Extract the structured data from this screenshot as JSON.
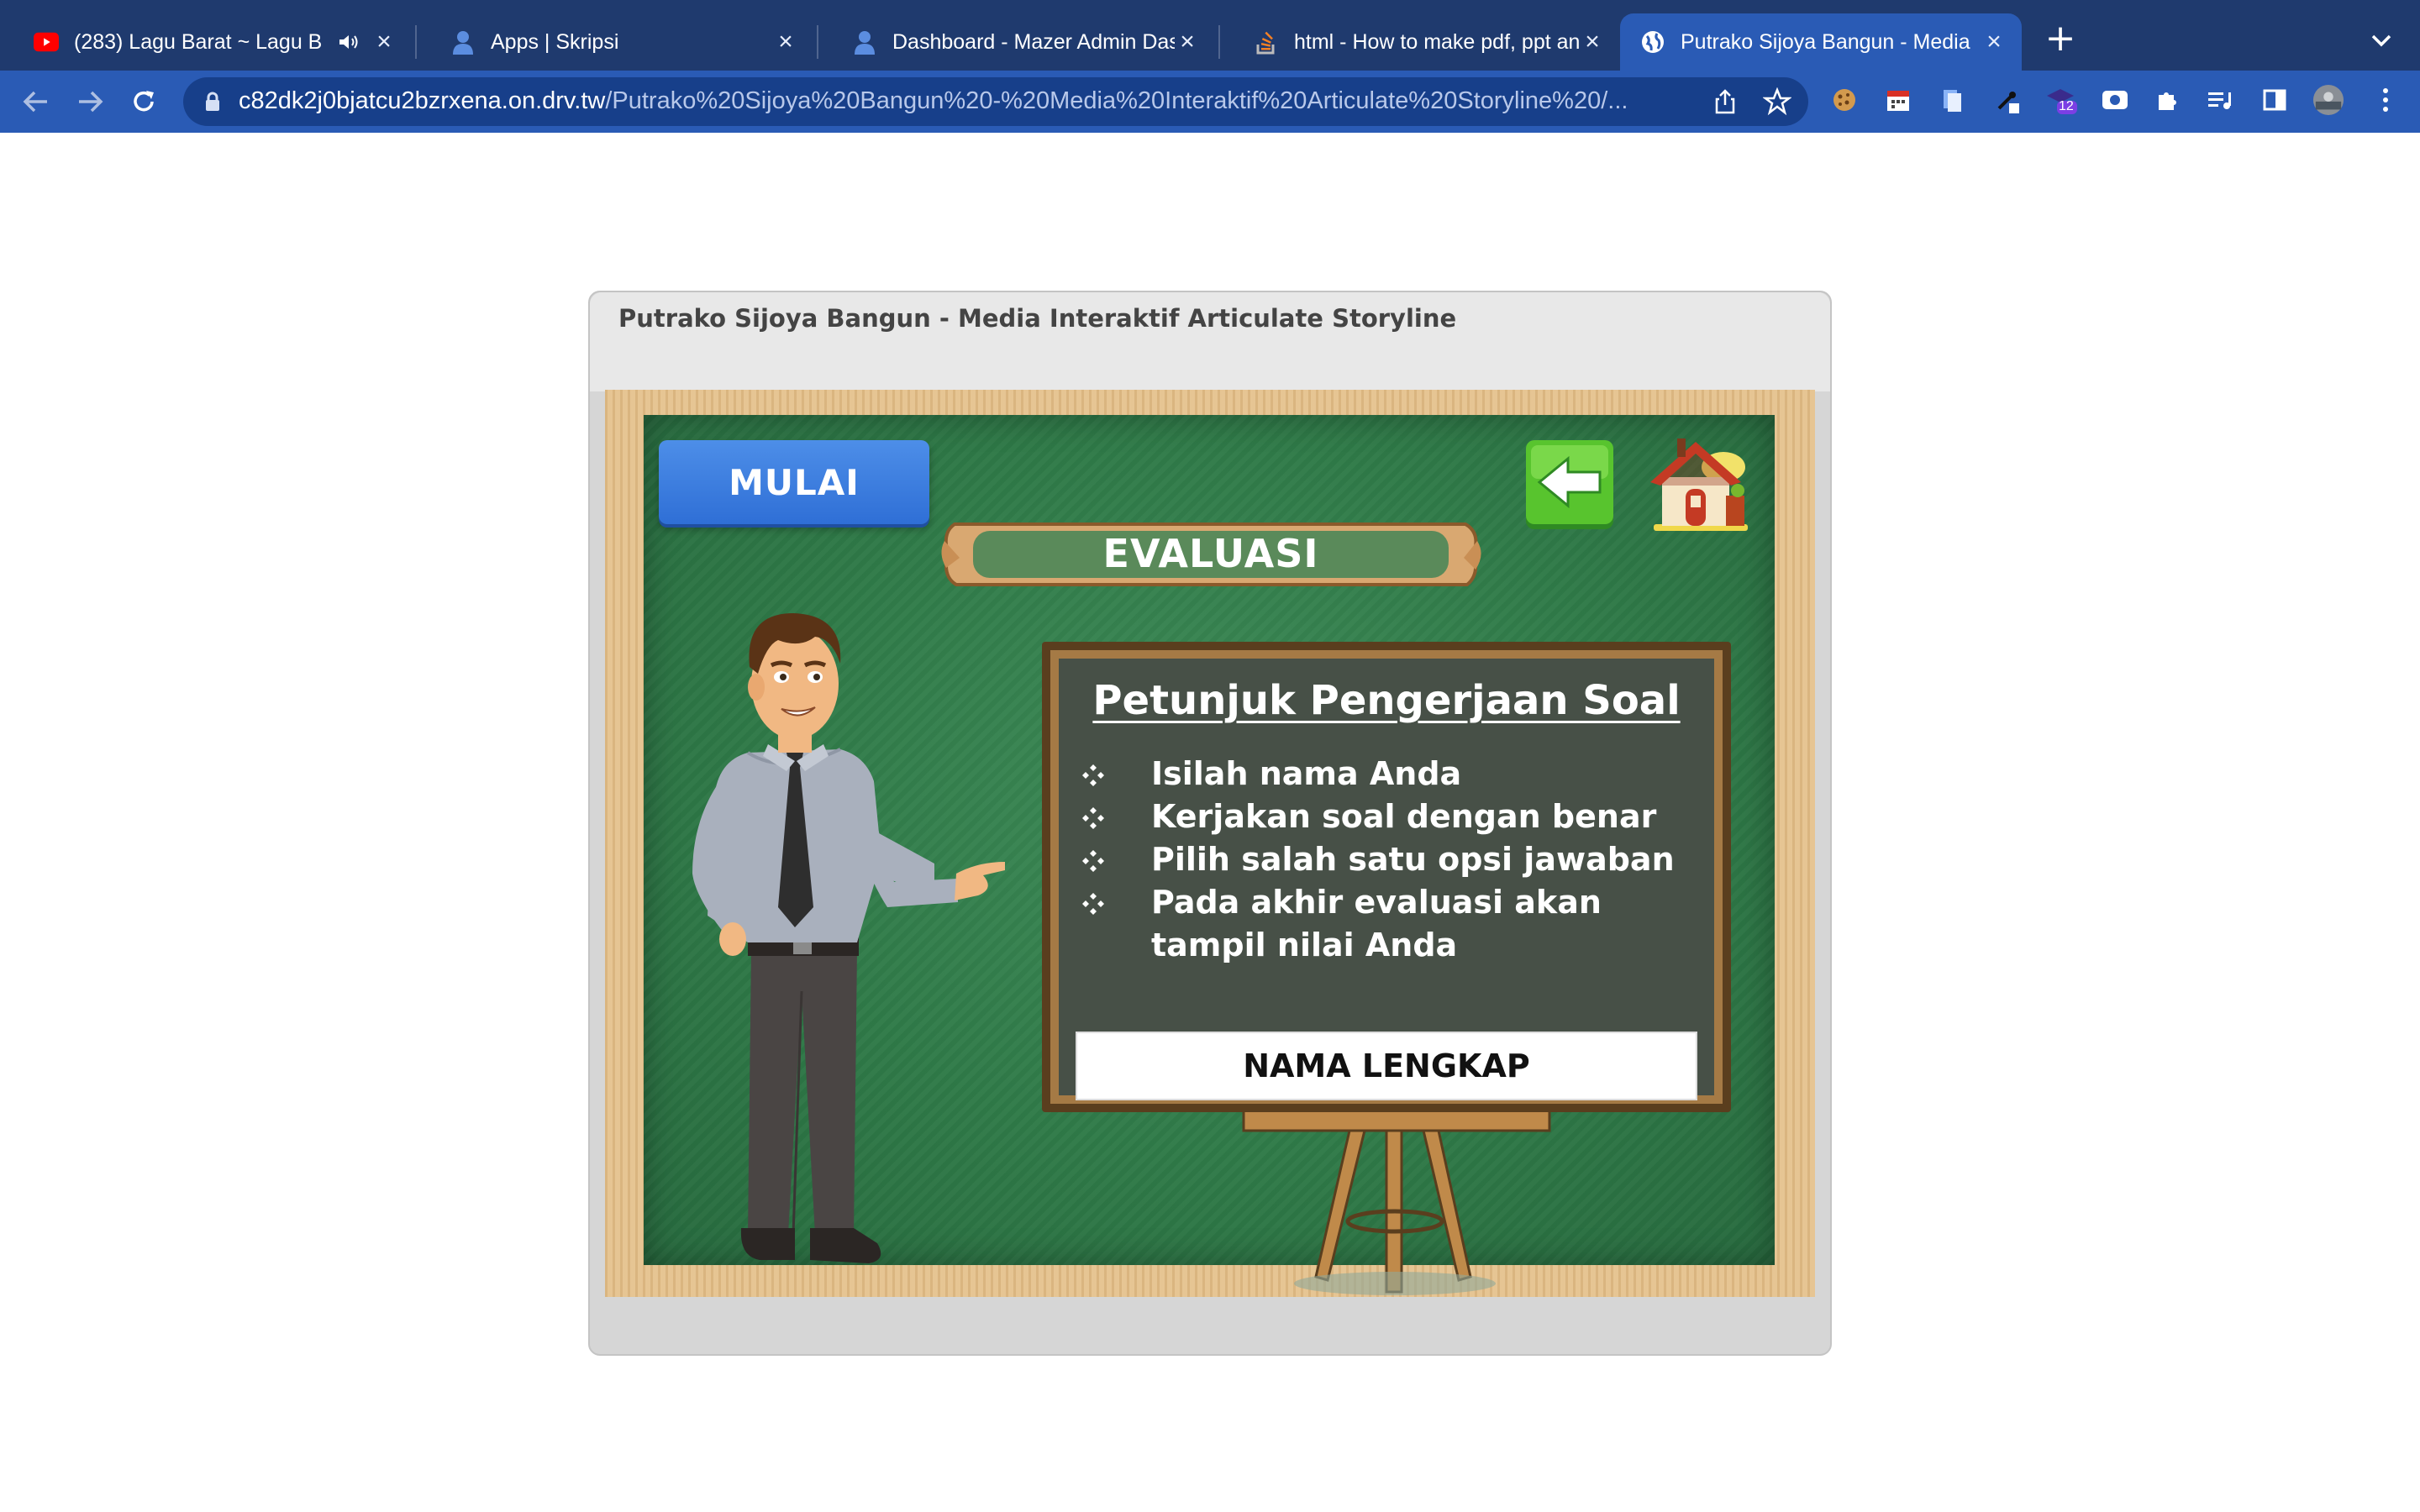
{
  "browser": {
    "tabs": [
      {
        "title": "(283) Lagu Barat ~ Lagu B",
        "icon": "youtube-icon",
        "audio": true
      },
      {
        "title": "Apps | Skripsi",
        "icon": "profile-icon"
      },
      {
        "title": "Dashboard - Mazer Admin Dash",
        "icon": "profile-icon"
      },
      {
        "title": "html - How to make pdf, ppt an",
        "icon": "stackoverflow-icon"
      },
      {
        "title": "Putrako Sijoya Bangun - Media",
        "icon": "globe-icon",
        "active": true
      }
    ],
    "url_host": "c82dk2j0bjatcu2bzrxena.on.drv.tw",
    "url_path": "/Putrako%20Sijoya%20Bangun%20-%20Media%20Interaktif%20Articulate%20Storyline%20/...",
    "extension_badge": "12"
  },
  "player": {
    "title": "Putrako Sijoya Bangun - Media Interaktif Articulate Storyline"
  },
  "slide": {
    "start_button": "MULAI",
    "banner": "EVALUASI",
    "instructions_title": "Petunjuk Pengerjaan Soal",
    "rules": [
      "Isilah nama Anda",
      "Kerjakan soal dengan benar",
      "Pilih salah satu opsi jawaban",
      "Pada akhir evaluasi akan tampil nilai Anda"
    ],
    "name_field": "NAMA LENGKAP"
  },
  "colors": {
    "tabbar": "#1f3a6e",
    "toolbar": "#2a5bb5",
    "board_green": "#2f7a48",
    "button_blue": "#2f6fd6",
    "frame_wood": "#e2c08c"
  }
}
